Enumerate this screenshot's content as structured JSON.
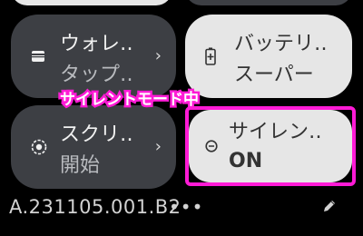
{
  "tiles": {
    "wallet": {
      "title": "ウォレ‥",
      "subtitle": "タップ‥",
      "icon": "wallet-icon"
    },
    "battery": {
      "title": "バッテリ‥",
      "subtitle": "スーパー",
      "icon": "battery-saver-icon"
    },
    "screen": {
      "title": "スクリ‥",
      "subtitle": "開始",
      "icon": "screen-record-icon"
    },
    "silent": {
      "title": "サイレン‥",
      "subtitle": "ON",
      "icon": "do-not-disturb-icon"
    }
  },
  "annotation": {
    "label": "サイレントモード中",
    "color": "#ff1bd6"
  },
  "footer": {
    "build_number": "A.231105.001.B2",
    "more": "•••",
    "edit_icon": "pencil-icon"
  },
  "colors": {
    "tile_dark": "#3d3f44",
    "tile_light": "#e6e6e6",
    "background": "#000000"
  }
}
